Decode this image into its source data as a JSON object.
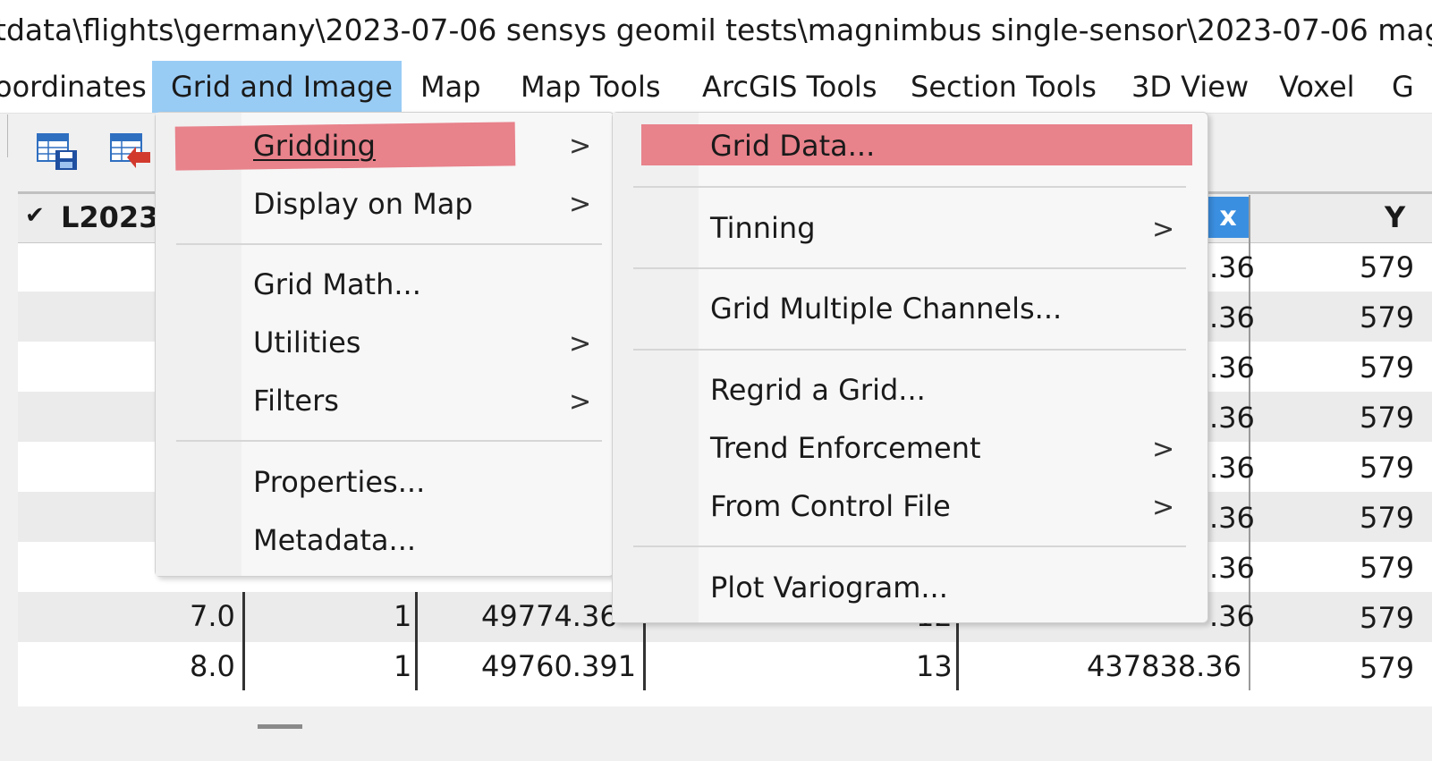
{
  "window": {
    "title": "tdata\\flights\\germany\\2023-07-06 sensys geomil tests\\magnimbus single-sensor\\2023-07-06 magnim"
  },
  "menubar": {
    "items": [
      {
        "label": "oordinates"
      },
      {
        "label": "Grid and Image",
        "active": true
      },
      {
        "label": "Map"
      },
      {
        "label": "Map Tools"
      },
      {
        "label": "ArcGIS Tools"
      },
      {
        "label": "Section Tools"
      },
      {
        "label": "3D View"
      },
      {
        "label": "Voxel"
      },
      {
        "label": "G"
      }
    ]
  },
  "colors": {
    "menu_active": "#99ccf5",
    "highlight": "#e8828b",
    "clear_button": "#3b8fe0"
  },
  "grid_menu": {
    "items": {
      "gridding": "Gridding",
      "display_on_map": "Display on Map",
      "grid_math": "Grid Math...",
      "utilities": "Utilities",
      "filters": "Filters",
      "properties": "Properties...",
      "metadata": "Metadata..."
    },
    "submenu_arrow": ">"
  },
  "gridding_submenu": {
    "items": {
      "grid_data": "Grid Data...",
      "tinning": "Tinning",
      "grid_multiple_channels": "Grid Multiple Channels...",
      "regrid_a_grid": "Regrid a Grid...",
      "trend_enforcement": "Trend Enforcement",
      "from_control_file": "From Control File",
      "plot_variogram": "Plot Variogram..."
    }
  },
  "spreadsheet": {
    "header": {
      "checkmark": "✔",
      "line_label": "L2023",
      "clear_button": "x",
      "y_column": "Y"
    },
    "x_fragments": [
      ".36",
      ".36",
      ".36",
      ".36",
      ".36",
      ".36",
      ".36"
    ],
    "y_fragments": [
      "579",
      "579",
      "579",
      "579",
      "579",
      "579",
      "579",
      "579",
      "579"
    ],
    "row8": {
      "fid": "7.0",
      "flag": "1",
      "value": "49774.36",
      "num": "12",
      "x": ".36"
    },
    "row9": {
      "fid": "8.0",
      "flag": "1",
      "value": "49760.391",
      "num": "13",
      "x": "437838.36"
    }
  }
}
